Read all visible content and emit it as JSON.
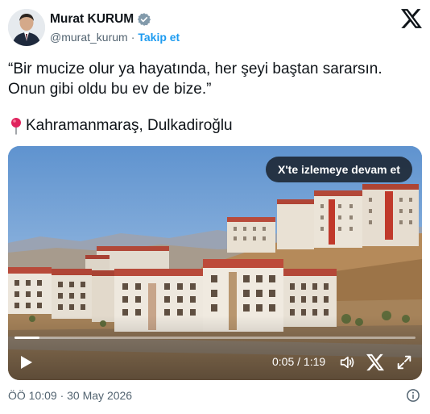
{
  "author": {
    "display_name": "Murat KURUM",
    "handle": "@murat_kurum",
    "separator": "·",
    "follow_label": "Takip et",
    "verified_color": "#829aab"
  },
  "tweet": {
    "line1": "“Bir mucize olur ya hayatında, her şeyi baştan sararsın.",
    "line2": "Onun gibi oldu bu ev de bize.”",
    "location_icon": "pin-icon",
    "location": "Kahramanmaraş, Dulkadiroğlu"
  },
  "video": {
    "continue_label": "X'te izlemeye devam et",
    "time_display": "0:05 / 1:19",
    "progress": 0.063,
    "icons": [
      "play-icon",
      "volume-icon",
      "x-brand-icon",
      "fullscreen-icon"
    ]
  },
  "footer": {
    "timestamp": "ÖÖ 10:09 · 30 May 2026",
    "info_icon": "info-icon"
  },
  "colors": {
    "link": "#1d9bf0",
    "text": "#0f1419",
    "muted": "#536471"
  }
}
